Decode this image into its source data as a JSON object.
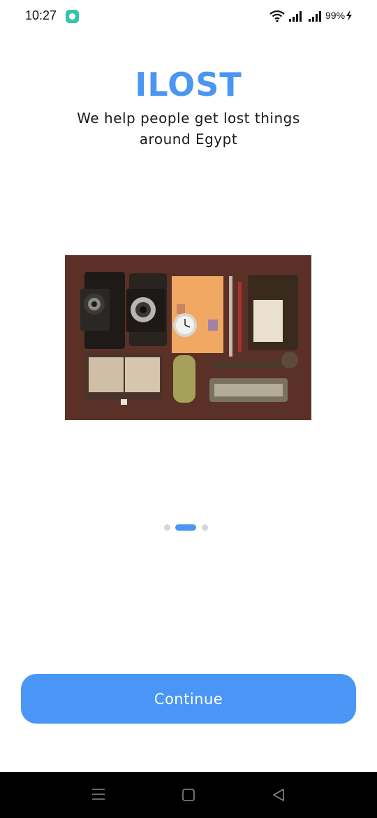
{
  "status_bar": {
    "time": "10:27",
    "battery": "99%",
    "icons": [
      "chat-notification-icon",
      "wifi-icon",
      "signal-icon",
      "signal-icon",
      "charging-icon"
    ]
  },
  "header": {
    "title": "ILOST",
    "subtitle": "We help people get lost things around Egypt"
  },
  "carousel": {
    "image": "vintage-objects-photo",
    "page_count": 3,
    "active_page": 2
  },
  "actions": {
    "continue_label": "Continue"
  },
  "nav_bar": {
    "icons": [
      "menu-icon",
      "home-icon",
      "back-icon"
    ]
  },
  "colors": {
    "accent": "#4a96f0",
    "button": "#4a96f7",
    "dot_inactive": "#d3d6db",
    "nav_bar": "#000000"
  }
}
